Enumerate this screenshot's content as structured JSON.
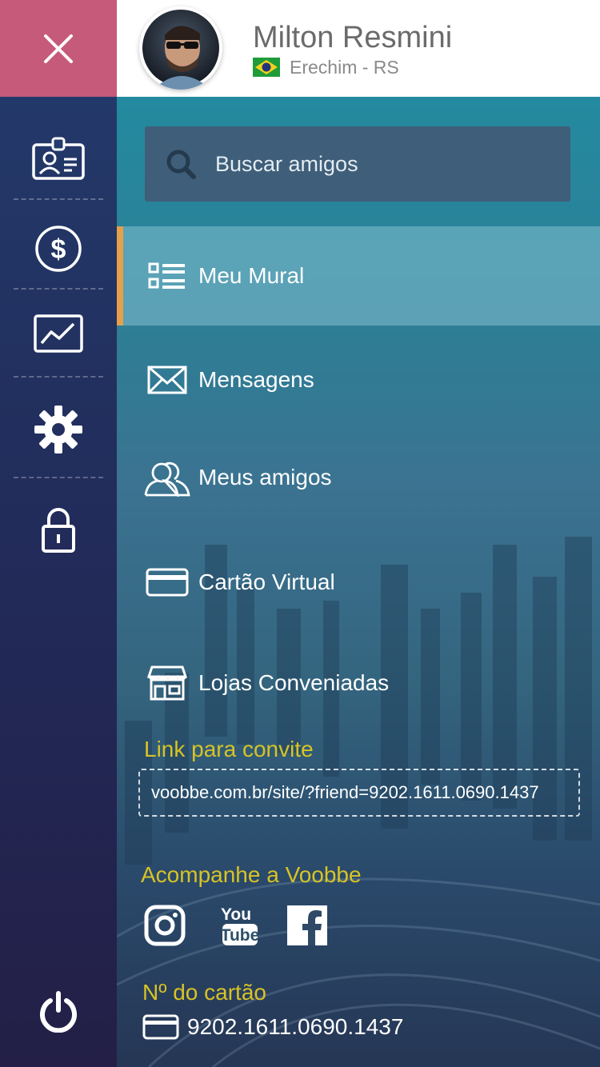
{
  "header": {
    "user_name": "Milton Resmini",
    "location": "Erechim - RS"
  },
  "search": {
    "placeholder": "Buscar amigos"
  },
  "menu": [
    {
      "label": "Meu Mural",
      "icon": "list-icon",
      "active": true
    },
    {
      "label": "Mensagens",
      "icon": "envelope-icon"
    },
    {
      "label": "Meus amigos",
      "icon": "friends-icon"
    },
    {
      "label": "Cartão Virtual",
      "icon": "card-icon"
    },
    {
      "label": "Lojas Conveniadas",
      "icon": "store-icon"
    }
  ],
  "invite": {
    "title": "Link para convite",
    "link": "voobbe.com.br/site/?friend=9202.1611.0690.1437"
  },
  "follow": {
    "title": "Acompanhe a Voobbe",
    "networks": [
      "instagram-icon",
      "youtube-icon",
      "facebook-icon"
    ]
  },
  "card": {
    "title": "Nº do cartão",
    "number": "9202.1611.0690.1437"
  },
  "rail_icons": [
    "close-icon",
    "id-card-icon",
    "dollar-icon",
    "chart-icon",
    "gear-icon",
    "lock-icon",
    "power-icon"
  ],
  "colors": {
    "close_bg": "#c65a7b",
    "accent_yellow": "#d8c324",
    "active_bar": "#e6a04a",
    "rail_top": "#233c6d",
    "rail_bottom": "#231f47"
  }
}
